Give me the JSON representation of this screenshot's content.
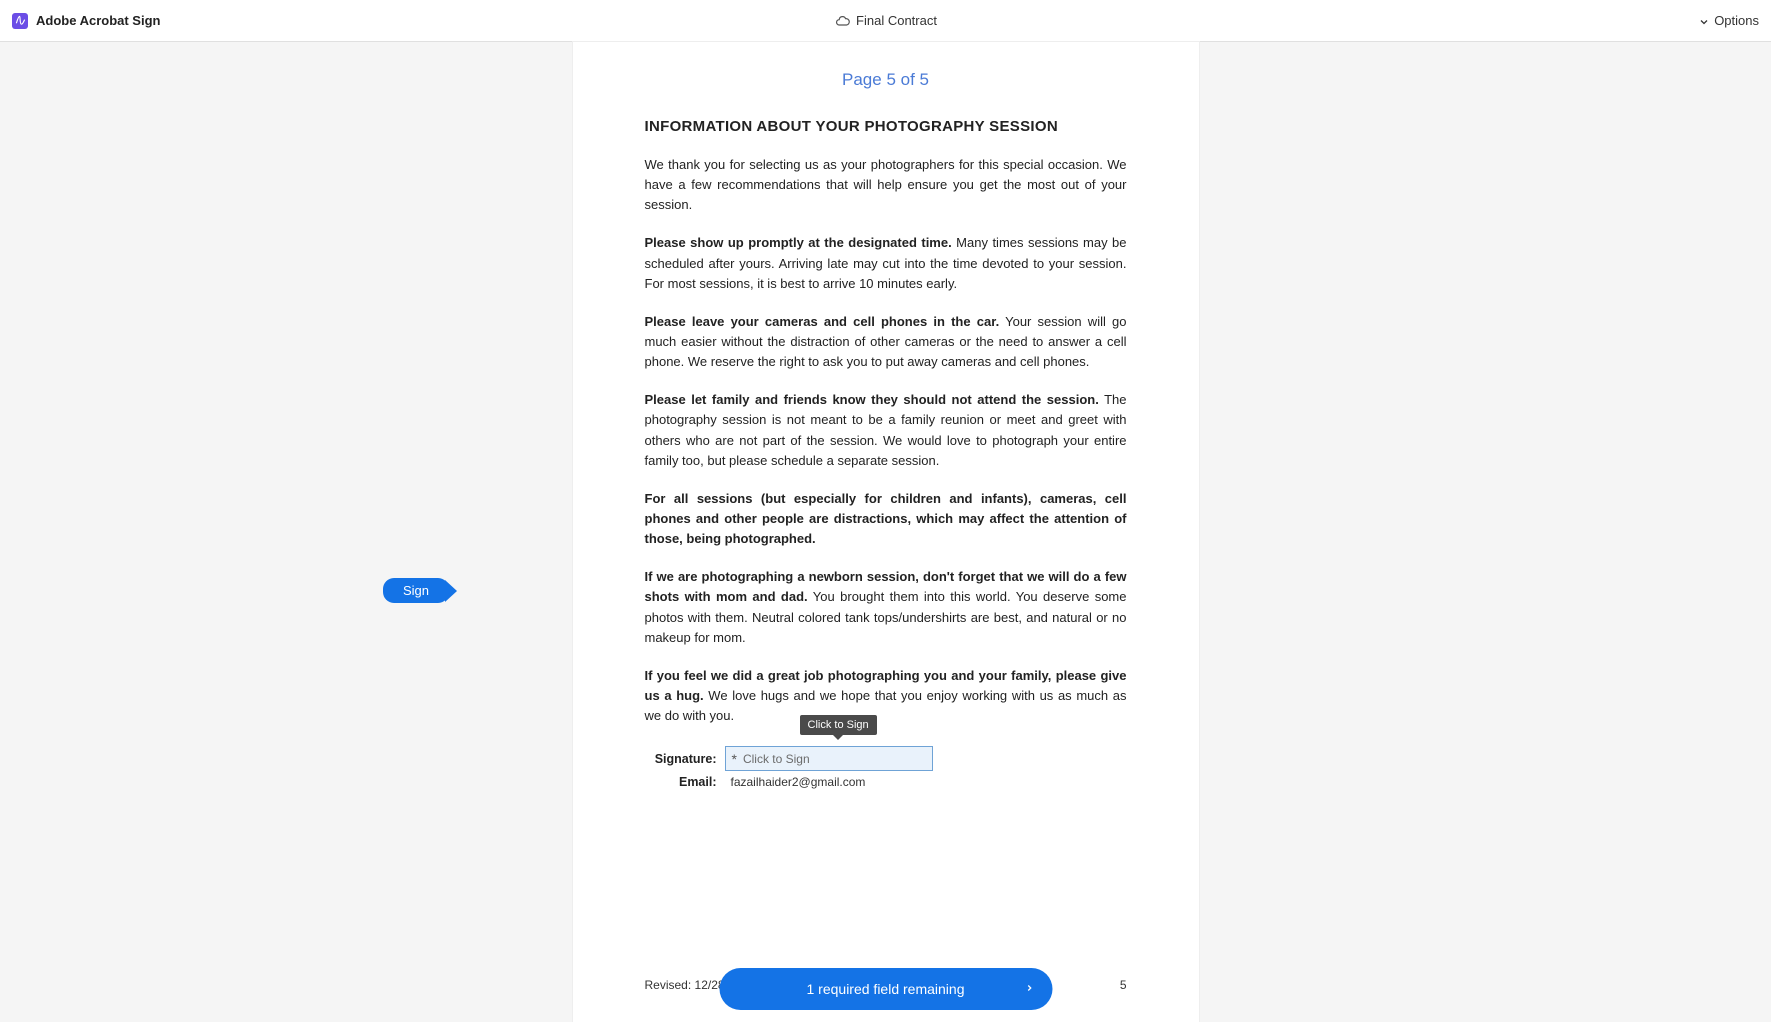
{
  "header": {
    "app_name": "Adobe Acrobat Sign",
    "doc_title": "Final Contract",
    "options_label": "Options"
  },
  "page_indicator": "Page 5 of 5",
  "section_title": "INFORMATION ABOUT YOUR PHOTOGRAPHY SESSION",
  "paragraphs": {
    "intro": "We thank you for selecting us as your photographers for this special occasion. We have a few recommendations that will help ensure you get the most out of your session.",
    "p1_bold": "Please show up promptly at the designated time.",
    "p1_rest": " Many times sessions may be scheduled after yours. Arriving late may cut into the time devoted to your session. For most sessions, it is best to arrive 10 minutes early.",
    "p2_bold": "Please leave your cameras and cell phones in the car.",
    "p2_rest": " Your session will go much easier without the distraction of other cameras or the need to answer a cell phone. We reserve the right to ask you to put away cameras and cell phones.",
    "p3_bold": "Please let family and friends know they should not attend the session.",
    "p3_rest": " The photography session is not meant to be a family reunion or meet and greet with others who are not part of the session. We would love to photograph your entire family too, but please schedule a separate session.",
    "p4_bold": "For all sessions (but especially for children and infants), cameras, cell phones and other people are distractions, which may affect the attention of those, being photographed.",
    "p5_bold": "If we are photographing a newborn session, don't forget that we will do a few shots with mom and dad.",
    "p5_rest": " You brought them into this world. You deserve some photos with them. Neutral colored tank tops/undershirts are best, and natural or no makeup for mom.",
    "p6_bold": "If you feel we did a great job photographing you and your family, please give us a hug.",
    "p6_rest": " We love hugs and we hope that you enjoy working with us as much as we do with you."
  },
  "signature": {
    "label": "Signature:",
    "placeholder": "Click to Sign",
    "tooltip": "Click to Sign"
  },
  "email": {
    "label": "Email:",
    "value": "fazailhaider2@gmail.com"
  },
  "sign_tag": "Sign",
  "footer": {
    "revised": "Revised: 12/28/2014",
    "page_num": "5"
  },
  "bottom_bar": {
    "text": "1 required field remaining"
  }
}
